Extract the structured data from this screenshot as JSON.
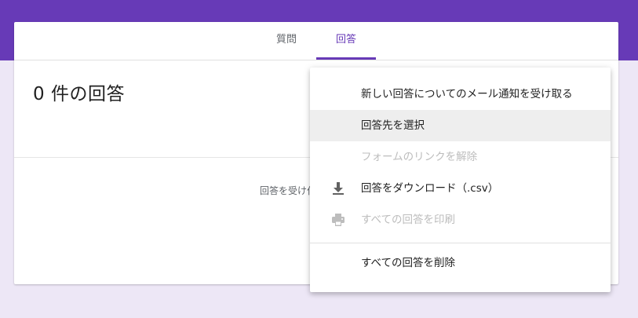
{
  "tabs": {
    "questions": "質問",
    "responses": "回答"
  },
  "main": {
    "response_count": "0 件の回答",
    "accepting_text": "回答を受け付"
  },
  "menu": {
    "items": [
      {
        "label": "新しい回答についてのメール通知を受け取る",
        "state": "enabled",
        "icon": ""
      },
      {
        "label": "回答先を選択",
        "state": "hover",
        "icon": ""
      },
      {
        "label": "フォームのリンクを解除",
        "state": "disabled",
        "icon": ""
      },
      {
        "label": "回答をダウンロード（.csv）",
        "state": "enabled",
        "icon": "download-icon"
      },
      {
        "label": "すべての回答を印刷",
        "state": "disabled",
        "icon": "print-icon"
      },
      {
        "label": "すべての回答を削除",
        "state": "enabled",
        "icon": ""
      }
    ]
  },
  "colors": {
    "brand": "#673ab7",
    "page_background": "#ede7f6",
    "disabled_text": "#bdbdbd",
    "hover_background": "#eeeeee"
  }
}
